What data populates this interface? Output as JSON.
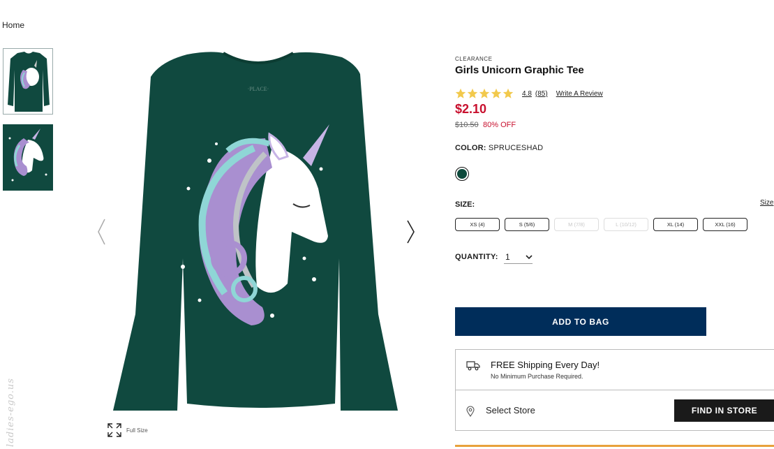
{
  "breadcrumb": {
    "home": "Home"
  },
  "gallery": {
    "thumbnails": [
      "unicorn-tee-front",
      "unicorn-graphic-closeup"
    ],
    "main_image": "girls-unicorn-graphic-tee",
    "fullsize_label": "Full Size"
  },
  "watermark": "ladies-ego.us",
  "product": {
    "tag": "CLEARANCE",
    "title": "Girls Unicorn Graphic Tee",
    "rating_value": "4.8",
    "rating_count": "(85)",
    "write_review": "Write A Review",
    "stars": 5,
    "price": "$2.10",
    "old_price": "$10.50",
    "discount": "80% OFF",
    "color_label": "COLOR:",
    "color_value": "SPRUCESHAD",
    "swatch_color": "#0e4a3c",
    "size_label": "SIZE:",
    "size_guide": "Size",
    "sizes": [
      {
        "label": "XS (4)",
        "available": true
      },
      {
        "label": "S (5/6)",
        "available": true
      },
      {
        "label": "M (7/8)",
        "available": false
      },
      {
        "label": "L (10/12)",
        "available": false
      },
      {
        "label": "XL (14)",
        "available": true
      },
      {
        "label": "XXL (16)",
        "available": true
      }
    ],
    "quantity_label": "QUANTITY:",
    "quantity_value": "1",
    "add_to_bag": "ADD TO BAG",
    "shipping_title": "FREE Shipping Every Day!",
    "shipping_sub": "No Minimum Purchase Required.",
    "select_store": "Select Store",
    "find_in_store": "FIND IN STORE"
  },
  "colors": {
    "accent": "#002d5a",
    "price": "#c8102e",
    "shirt": "#10493f",
    "star": "#f2c94c",
    "orange": "#e8a13b"
  }
}
